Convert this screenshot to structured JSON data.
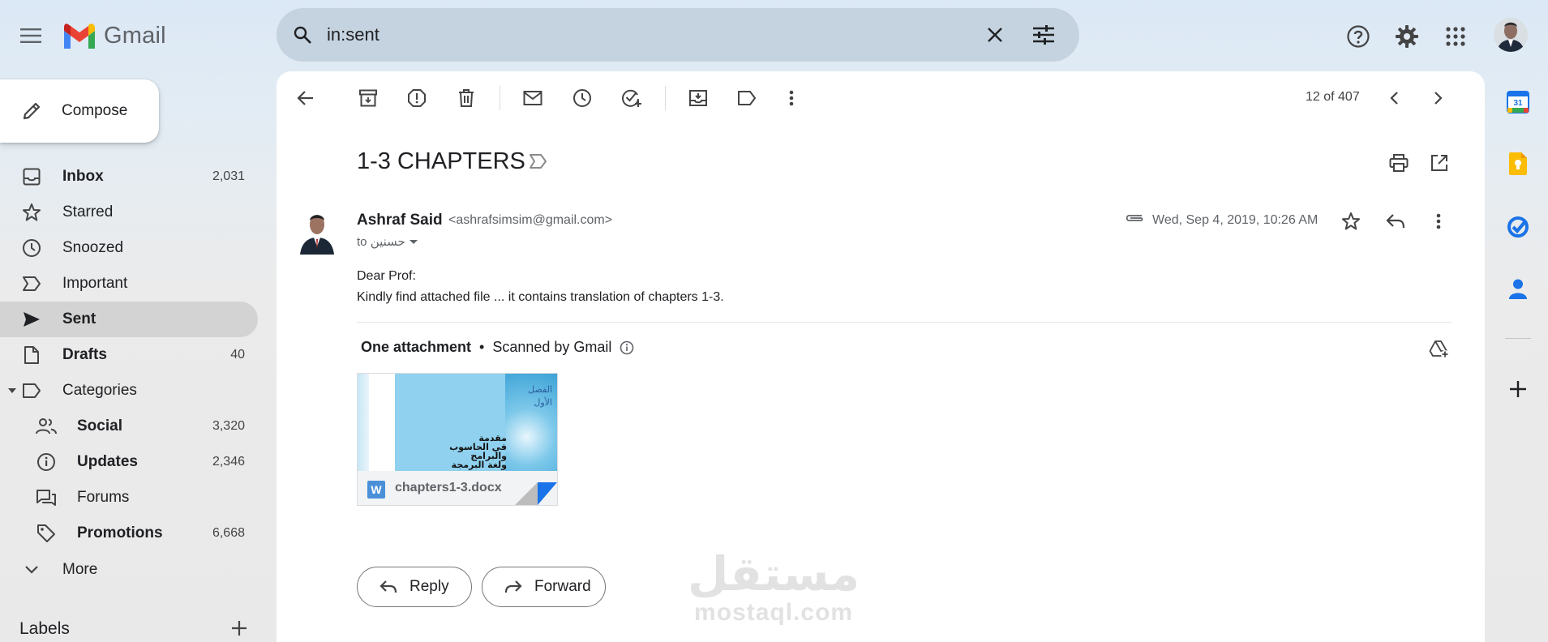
{
  "app": {
    "name": "Gmail"
  },
  "search": {
    "query": "in:sent"
  },
  "compose": {
    "label": "Compose"
  },
  "nav": [
    {
      "id": "inbox",
      "label": "Inbox",
      "count": "2,031",
      "bold": true
    },
    {
      "id": "starred",
      "label": "Starred",
      "count": ""
    },
    {
      "id": "snoozed",
      "label": "Snoozed",
      "count": ""
    },
    {
      "id": "important",
      "label": "Important",
      "count": ""
    },
    {
      "id": "sent",
      "label": "Sent",
      "count": "",
      "bold": true,
      "active": true
    },
    {
      "id": "drafts",
      "label": "Drafts",
      "count": "40",
      "bold": true
    },
    {
      "id": "categories",
      "label": "Categories",
      "count": ""
    }
  ],
  "categories": [
    {
      "id": "social",
      "label": "Social",
      "count": "3,320",
      "bold": true
    },
    {
      "id": "updates",
      "label": "Updates",
      "count": "2,346",
      "bold": true
    },
    {
      "id": "forums",
      "label": "Forums",
      "count": ""
    },
    {
      "id": "promotions",
      "label": "Promotions",
      "count": "6,668",
      "bold": true
    }
  ],
  "more": {
    "label": "More"
  },
  "labels": {
    "title": "Labels"
  },
  "toolbar": {
    "page_count": "12 of 407"
  },
  "email": {
    "subject": "1-3 CHAPTERS",
    "sender_name": "Ashraf Said",
    "sender_email": "<ashrafsimsim@gmail.com>",
    "to": "to حسنين",
    "date": "Wed, Sep 4, 2019, 10:26 AM",
    "body_line1": "Dear Prof:",
    "body_line2": "Kindly find attached file ... it contains translation of chapters 1-3."
  },
  "attachments": {
    "title": "One attachment",
    "separator": "•",
    "scanned": "Scanned by Gmail",
    "file_name": "chapters1-3.docx",
    "file_badge": "W",
    "thumb_title_line1": "الفصل",
    "thumb_title_line2": "الأول",
    "thumb_text_line1": "مقدمة",
    "thumb_text_line2": "في الحاسوب",
    "thumb_text_line3": "والبرامج",
    "thumb_text_line4": "ولغة البرمجة"
  },
  "actions": {
    "reply": "Reply",
    "forward": "Forward"
  },
  "watermark": {
    "arabic": "مستقل",
    "latin": "mostaql.com"
  },
  "side_panel": {
    "calendar_day": "31"
  },
  "colors": {
    "accent": "#1a73e8",
    "active_nav": "#d3d3d3",
    "search_bg": "#c4d3df"
  }
}
